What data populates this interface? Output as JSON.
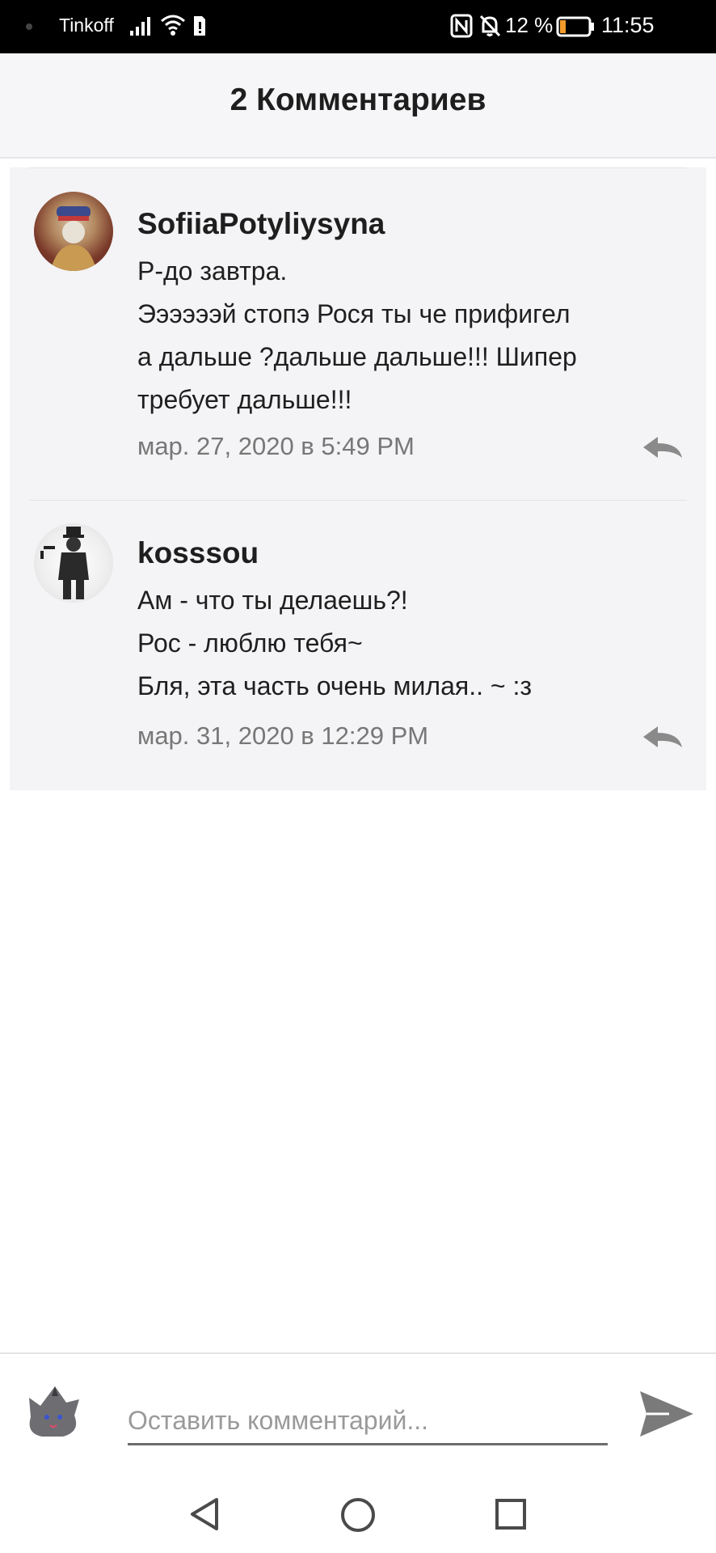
{
  "status_bar": {
    "carrier": "Tinkoff",
    "battery_percent": "12 %",
    "time": "11:55",
    "icons": [
      "signal-icon",
      "wifi-icon",
      "sim-icon",
      "nfc-icon",
      "bell-off-icon",
      "battery-icon"
    ]
  },
  "header": {
    "title": "2 Комментариев"
  },
  "comments": [
    {
      "username": "SofiiaPotyliysyna",
      "lines": [
        "Р-до завтра.",
        "Ээээээй стопэ Рося ты че прифигел",
        "а дальше ?дальше дальше!!! Шипер",
        "требует дальше!!!"
      ],
      "timestamp": "мар. 27, 2020 в 5:49 PM",
      "reply_icon": "reply-icon"
    },
    {
      "username": "kosssou",
      "lines": [
        "Ам - что ты делаешь?!",
        "Рос - люблю тебя~",
        "Бля, эта часть очень милая.. ~ :з"
      ],
      "timestamp": "мар. 31, 2020 в 12:29 PM",
      "reply_icon": "reply-icon"
    }
  ],
  "composer": {
    "placeholder": "Оставить комментарий...",
    "value": "",
    "send_icon": "send-icon"
  },
  "nav_bar": {
    "icons": [
      "back-icon",
      "home-icon",
      "recent-apps-icon"
    ]
  },
  "colors": {
    "status_bar_bg": "#000000",
    "header_bg": "#f6f5f7",
    "comment_bg": "#f4f3f5",
    "meta_text": "#777777",
    "icon_gray": "#8a8a8a"
  }
}
